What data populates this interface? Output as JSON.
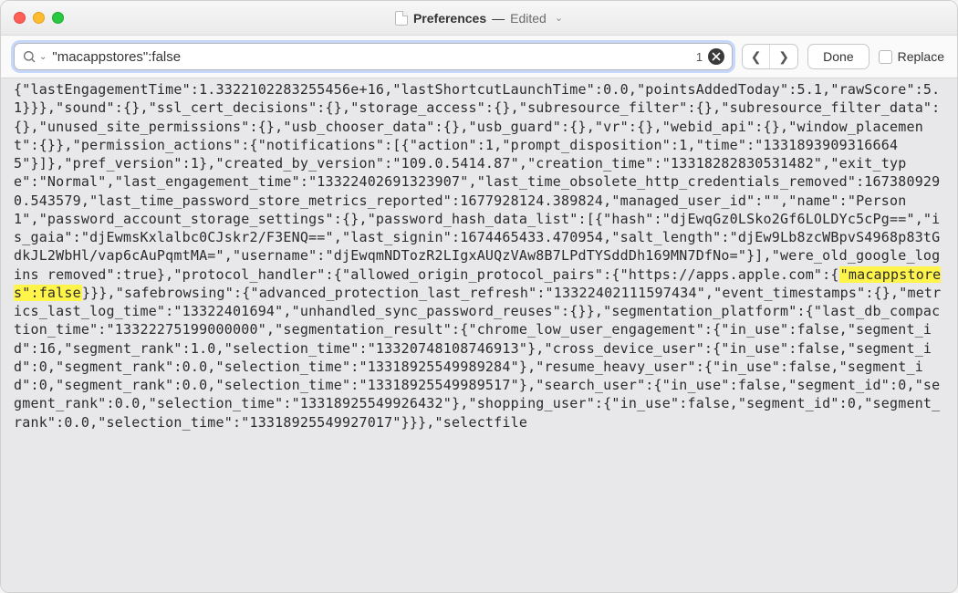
{
  "title": {
    "filename": "Preferences",
    "separator": " — ",
    "state": "Edited"
  },
  "find": {
    "query": "\"macappstores\":false",
    "count": "1",
    "done": "Done",
    "replace_label": "Replace"
  },
  "content": {
    "pre": "{\"lastEngagementTime\":1.3322102283255456e+16,\"lastShortcutLaunchTime\":0.0,\"pointsAddedToday\":5.1,\"rawScore\":5.1}}},\"sound\":{},\"ssl_cert_decisions\":{},\"storage_access\":{},\"subresource_filter\":{},\"subresource_filter_data\":{},\"unused_site_permissions\":{},\"usb_chooser_data\":{},\"usb_guard\":{},\"vr\":{},\"webid_api\":{},\"window_placement\":{}},\"permission_actions\":{\"notifications\":[{\"action\":1,\"prompt_disposition\":1,\"time\":\"13318939093166645\"}]},\"pref_version\":1},\"created_by_version\":\"109.0.5414.87\",\"creation_time\":\"13318282830531482\",\"exit_type\":\"Normal\",\"last_engagement_time\":\"13322402691323907\",\"last_time_obsolete_http_credentials_removed\":1673809290.543579,\"last_time_password_store_metrics_reported\":1677928124.389824,\"managed_user_id\":\"\",\"name\":\"Person 1\",\"password_account_storage_settings\":{},\"password_hash_data_list\":[{\"hash\":\"djEwqGz0LSko2Gf6LOLDYc5cPg==\",\"is_gaia\":\"djEwmsKxlalbc0CJskr2/F3ENQ==\",\"last_signin\":1674465433.470954,\"salt_length\":\"djEw9Lb8zcWBpvS4968p83tGdkJL2WbHl/vap6cAuPqmtMA=\",\"username\":\"djEwqmNDTozR2LIgxAUQzVAw8B7LPdTYSddDh169MN7DfNo=\"}],\"were_old_google_logins removed\":true},\"protocol_handler\":{\"allowed_origin_protocol_pairs\":{\"https://apps.apple.com\":{",
    "match": "\"macappstores\":false",
    "post": "}}},\"safebrowsing\":{\"advanced_protection_last_refresh\":\"13322402111597434\",\"event_timestamps\":{},\"metrics_last_log_time\":\"13322401694\",\"unhandled_sync_password_reuses\":{}},\"segmentation_platform\":{\"last_db_compaction_time\":\"13322275199000000\",\"segmentation_result\":{\"chrome_low_user_engagement\":{\"in_use\":false,\"segment_id\":16,\"segment_rank\":1.0,\"selection_time\":\"13320748108746913\"},\"cross_device_user\":{\"in_use\":false,\"segment_id\":0,\"segment_rank\":0.0,\"selection_time\":\"13318925549989284\"},\"resume_heavy_user\":{\"in_use\":false,\"segment_id\":0,\"segment_rank\":0.0,\"selection_time\":\"13318925549989517\"},\"search_user\":{\"in_use\":false,\"segment_id\":0,\"segment_rank\":0.0,\"selection_time\":\"13318925549926432\"},\"shopping_user\":{\"in_use\":false,\"segment_id\":0,\"segment_rank\":0.0,\"selection_time\":\"13318925549927017\"}}},\"selectfile"
  }
}
